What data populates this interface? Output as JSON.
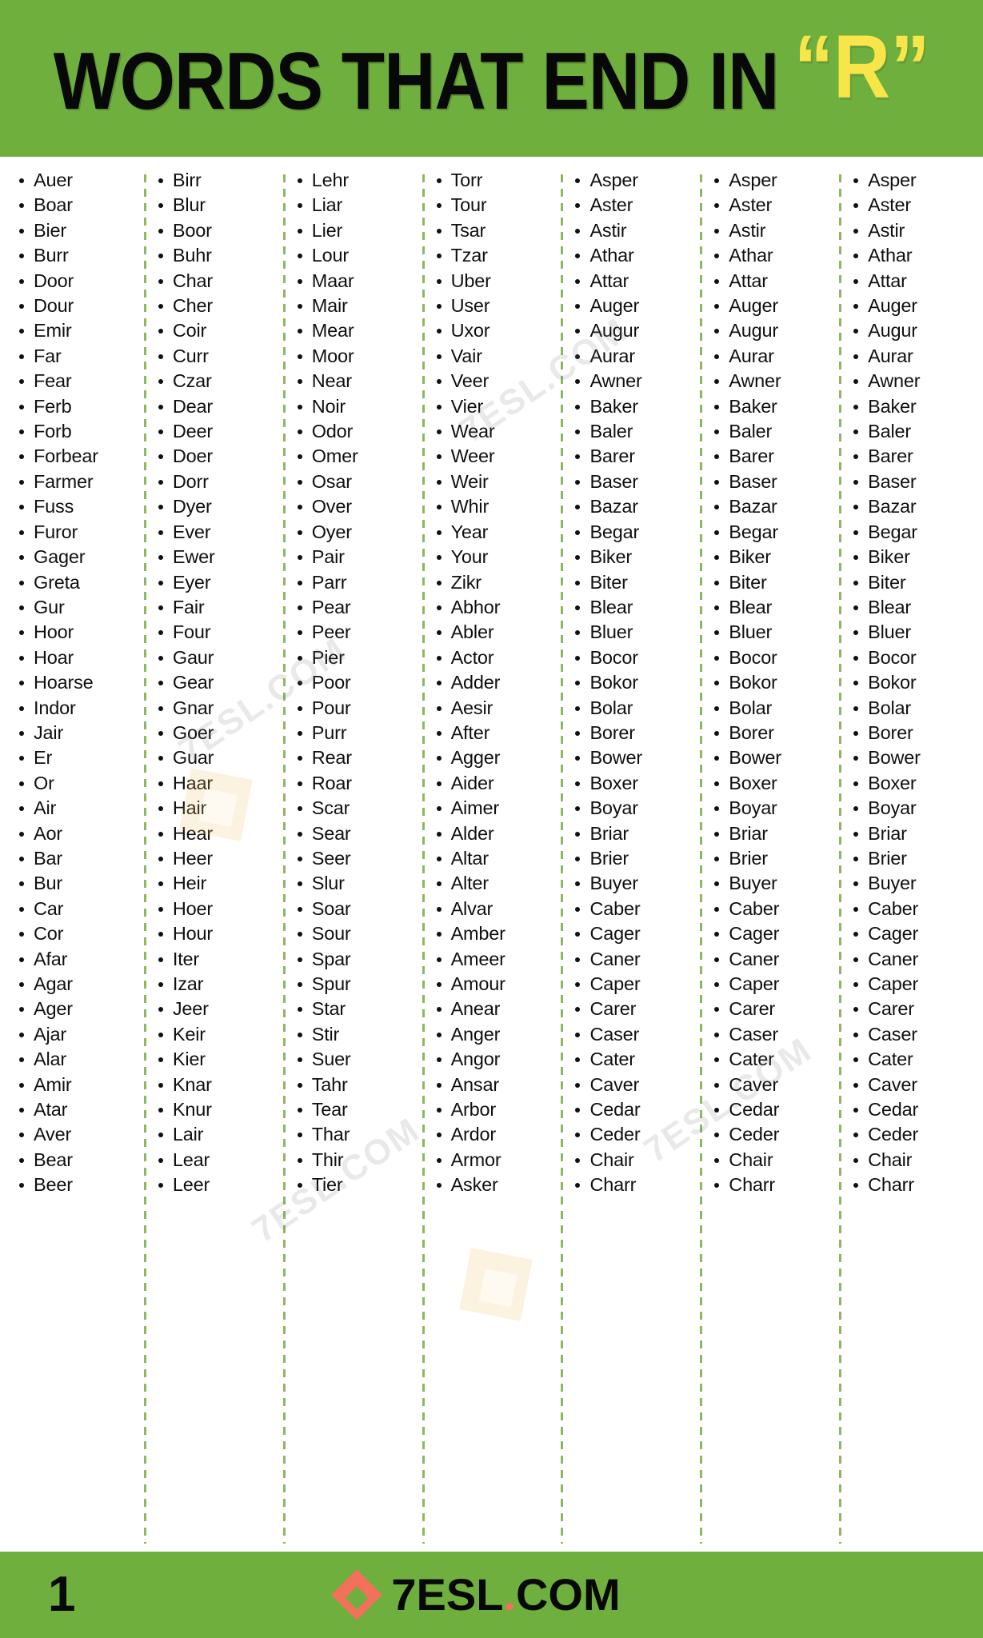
{
  "header": {
    "title_main": "WORDS THAT END IN",
    "title_accent": "“R”",
    "background_color": "#6FAF3E",
    "accent_color": "#F7E54A",
    "text_color": "#080808"
  },
  "footer": {
    "page_number": "1",
    "brand_prefix": "7ESL",
    "brand_dot": ".",
    "brand_suffix": "COM",
    "brand_full": "7ESL.COM",
    "logo_color": "#F5705A",
    "background_color": "#6FAF3E"
  },
  "watermarks": [
    {
      "text": "7ESL.COM"
    },
    {
      "text": "7ESL.COM"
    },
    {
      "text": "7ESL.COM"
    },
    {
      "text": "7ESL.COM"
    }
  ],
  "columns": [
    {
      "id": "column-1",
      "words": [
        "Auer",
        "Boar",
        "Bier",
        "Burr",
        "Door",
        "Dour",
        "Emir",
        "Far",
        "Fear",
        "Ferb",
        "Forb",
        "Forbear",
        "Farmer",
        "Fuss",
        "Furor",
        "Gager",
        "Greta",
        "Gur",
        "Hoor",
        "Hoar",
        "Hoarse",
        "Indor",
        "Jair",
        "Er",
        "Or",
        "Air",
        "Aor",
        "Bar",
        "Bur",
        "Car",
        "Cor",
        "Afar",
        "Agar",
        "Ager",
        "Ajar",
        "Alar",
        "Amir",
        "Atar",
        "Aver",
        "Bear",
        "Beer"
      ]
    },
    {
      "id": "column-2",
      "words": [
        "Birr",
        "Blur",
        "Boor",
        "Buhr",
        "Char",
        "Cher",
        "Coir",
        "Curr",
        "Czar",
        "Dear",
        "Deer",
        "Doer",
        "Dorr",
        "Dyer",
        "Ever",
        "Ewer",
        "Eyer",
        "Fair",
        "Four",
        "Gaur",
        "Gear",
        "Gnar",
        "Goer",
        "Guar",
        "Haar",
        "Hair",
        "Hear",
        "Heer",
        "Heir",
        "Hoer",
        "Hour",
        "Iter",
        "Izar",
        "Jeer",
        "Keir",
        "Kier",
        "Knar",
        "Knur",
        "Lair",
        "Lear",
        "Leer"
      ]
    },
    {
      "id": "column-3",
      "words": [
        "Lehr",
        "Liar",
        "Lier",
        "Lour",
        "Maar",
        "Mair",
        "Mear",
        "Moor",
        "Near",
        "Noir",
        "Odor",
        "Omer",
        "Osar",
        "Over",
        "Oyer",
        "Pair",
        "Parr",
        "Pear",
        "Peer",
        "Pier",
        "Poor",
        "Pour",
        "Purr",
        "Rear",
        "Roar",
        "Scar",
        "Sear",
        "Seer",
        "Slur",
        "Soar",
        "Sour",
        "Spar",
        "Spur",
        "Star",
        "Stir",
        "Suer",
        "Tahr",
        "Tear",
        "Thar",
        "Thir",
        "Tier"
      ]
    },
    {
      "id": "column-4",
      "words": [
        "Torr",
        "Tour",
        "Tsar",
        "Tzar",
        "Uber",
        "User",
        "Uxor",
        "Vair",
        "Veer",
        "Vier",
        "Wear",
        "Weer",
        "Weir",
        "Whir",
        "Year",
        "Your",
        "Zikr",
        "Abhor",
        "Abler",
        "Actor",
        "Adder",
        "Aesir",
        "After",
        "Agger",
        "Aider",
        "Aimer",
        "Alder",
        "Altar",
        "Alter",
        "Alvar",
        "Amber",
        "Ameer",
        "Amour",
        "Anear",
        "Anger",
        "Angor",
        "Ansar",
        "Arbor",
        "Ardor",
        "Armor",
        "Asker"
      ]
    },
    {
      "id": "column-5",
      "words": [
        "Asper",
        "Aster",
        "Astir",
        "Athar",
        "Attar",
        "Auger",
        "Augur",
        "Aurar",
        "Awner",
        "Baker",
        "Baler",
        "Barer",
        "Baser",
        "Bazar",
        "Begar",
        "Biker",
        "Biter",
        "Blear",
        "Bluer",
        "Bocor",
        "Bokor",
        "Bolar",
        "Borer",
        "Bower",
        "Boxer",
        "Boyar",
        "Briar",
        "Brier",
        "Buyer",
        "Caber",
        "Cager",
        "Caner",
        "Caper",
        "Carer",
        "Caser",
        "Cater",
        "Caver",
        "Cedar",
        "Ceder",
        "Chair",
        "Charr"
      ]
    },
    {
      "id": "column-6",
      "words": [
        "Asper",
        "Aster",
        "Astir",
        "Athar",
        "Attar",
        "Auger",
        "Augur",
        "Aurar",
        "Awner",
        "Baker",
        "Baler",
        "Barer",
        "Baser",
        "Bazar",
        "Begar",
        "Biker",
        "Biter",
        "Blear",
        "Bluer",
        "Bocor",
        "Bokor",
        "Bolar",
        "Borer",
        "Bower",
        "Boxer",
        "Boyar",
        "Briar",
        "Brier",
        "Buyer",
        "Caber",
        "Cager",
        "Caner",
        "Caper",
        "Carer",
        "Caser",
        "Cater",
        "Caver",
        "Cedar",
        "Ceder",
        "Chair",
        "Charr"
      ]
    },
    {
      "id": "column-7",
      "words": [
        "Asper",
        "Aster",
        "Astir",
        "Athar",
        "Attar",
        "Auger",
        "Augur",
        "Aurar",
        "Awner",
        "Baker",
        "Baler",
        "Barer",
        "Baser",
        "Bazar",
        "Begar",
        "Biker",
        "Biter",
        "Blear",
        "Bluer",
        "Bocor",
        "Bokor",
        "Bolar",
        "Borer",
        "Bower",
        "Boxer",
        "Boyar",
        "Briar",
        "Brier",
        "Buyer",
        "Caber",
        "Cager",
        "Caner",
        "Caper",
        "Carer",
        "Caser",
        "Cater",
        "Caver",
        "Cedar",
        "Ceder",
        "Chair",
        "Charr"
      ]
    }
  ]
}
